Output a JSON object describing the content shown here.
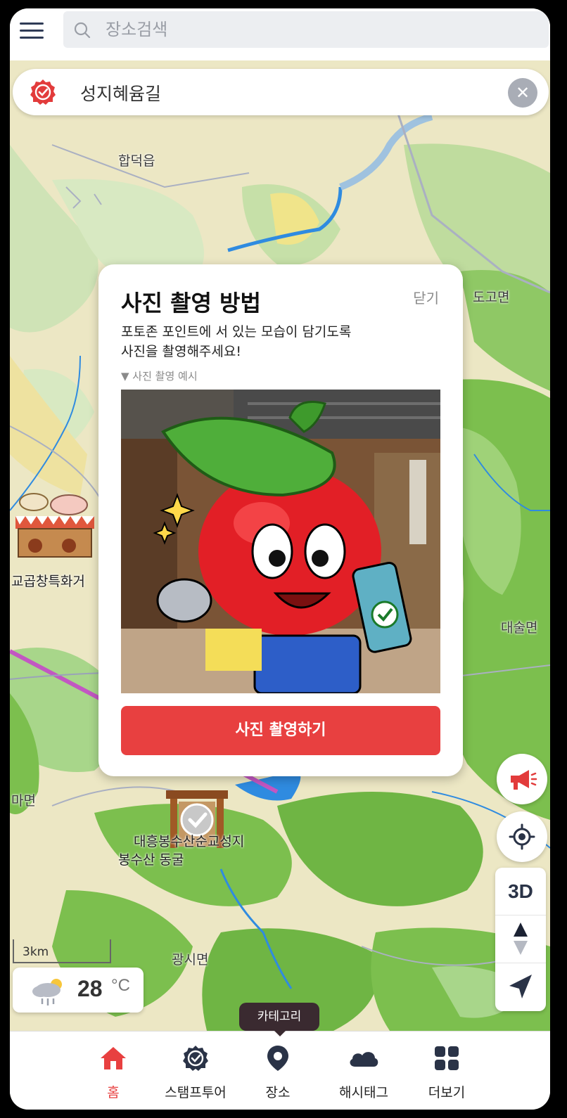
{
  "search": {
    "placeholder": "장소검색"
  },
  "route": {
    "title": "성지혜윰길"
  },
  "map": {
    "labels": {
      "hapdeok": "합덕읍",
      "dogo": "도고면",
      "daesul": "대술면",
      "ma": "마면",
      "gwangsi": "광시면"
    },
    "pois": {
      "gopchang": "교곱창특화거",
      "bongsusan": "대흥봉수산순교성지",
      "donggul": "봉수산 동굴"
    },
    "scale": "3km"
  },
  "modal": {
    "title": "사진 촬영 방법",
    "close": "닫기",
    "description": "포토존 포인트에 서 있는 모습이 담기도록\n사진을 촬영해주세요!",
    "example_toggle": "▼ 사진 촬영 예시",
    "shoot_button": "사진 촬영하기"
  },
  "controls": {
    "three_d": "3D"
  },
  "weather": {
    "temperature": "28",
    "unit": "°C"
  },
  "tooltip": "카테고리",
  "nav": {
    "items": [
      {
        "label": "홈",
        "icon": "home-icon",
        "active": true
      },
      {
        "label": "스탬프투어",
        "icon": "stamp-badge-icon",
        "active": false
      },
      {
        "label": "장소",
        "icon": "location-pin-icon",
        "active": false
      },
      {
        "label": "해시태그",
        "icon": "cloud-icon",
        "active": false
      },
      {
        "label": "더보기",
        "icon": "grid-icon",
        "active": false
      }
    ]
  },
  "colors": {
    "accent": "#e84040",
    "nav_active": "#e84040",
    "ui_dark": "#2a3347"
  }
}
